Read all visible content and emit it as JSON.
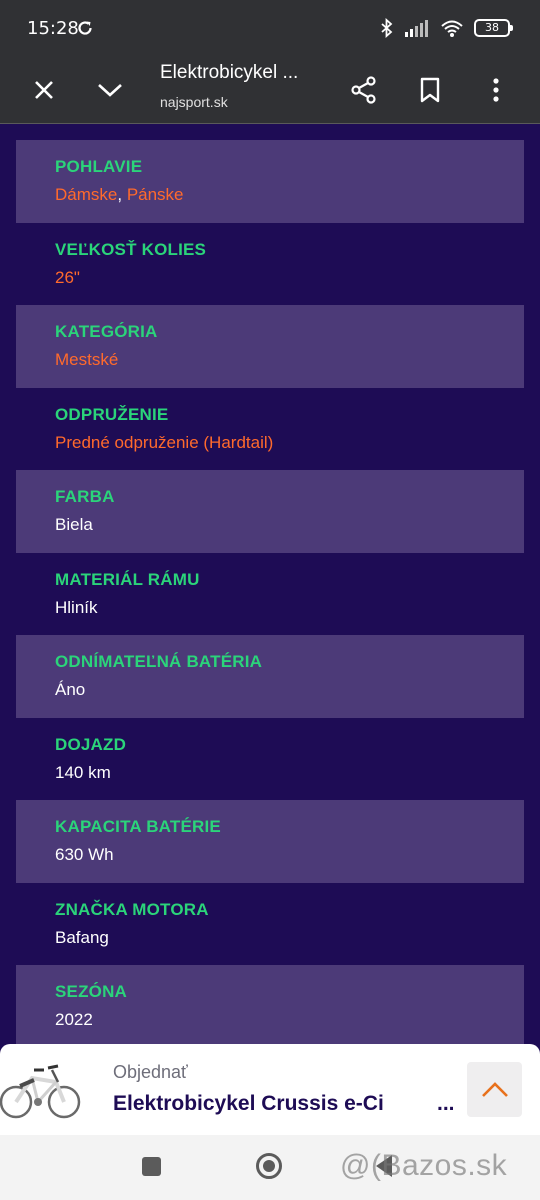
{
  "status_bar": {
    "time": "15:28",
    "battery": "38"
  },
  "toolbar": {
    "title": "Elektrobicykel ...",
    "domain": "najsport.sk"
  },
  "specs": [
    {
      "label": "POHLAVIE",
      "values": [
        "Dámske",
        "Pánske"
      ],
      "separator": ", ",
      "style": "link"
    },
    {
      "label": "VEĽKOSŤ KOLIES",
      "values": [
        "26\""
      ],
      "style": "link"
    },
    {
      "label": "KATEGÓRIA",
      "values": [
        "Mestské"
      ],
      "style": "link"
    },
    {
      "label": "ODPRUŽENIE",
      "values": [
        "Predné odpruženie (Hardtail)"
      ],
      "style": "link"
    },
    {
      "label": "FARBA",
      "values": [
        "Biela"
      ],
      "style": "plain"
    },
    {
      "label": "MATERIÁL RÁMU",
      "values": [
        "Hliník"
      ],
      "style": "plain"
    },
    {
      "label": "ODNÍMATEĽNÁ BATÉRIA",
      "values": [
        "Áno"
      ],
      "style": "plain"
    },
    {
      "label": "DOJAZD",
      "values": [
        "140 km"
      ],
      "style": "plain"
    },
    {
      "label": "KAPACITA BATÉRIE",
      "values": [
        "630 Wh"
      ],
      "style": "plain"
    },
    {
      "label": "ZNAČKA MOTORA",
      "values": [
        "Bafang"
      ],
      "style": "plain"
    },
    {
      "label": "SEZÓNA",
      "values": [
        "2022"
      ],
      "style": "plain"
    }
  ],
  "order_bar": {
    "label": "Objednať",
    "product": "Elektrobicykel Crussis e-Ci",
    "ellipsis": "..."
  },
  "watermark": "@(Bazos.sk",
  "colors": {
    "page_bg": "#1e0c55",
    "row_shaded": "#4c3a78",
    "label": "#2bd47a",
    "link": "#ff6a2c",
    "toolbar": "#303134",
    "up_arrow": "#e8711c"
  },
  "icons": {
    "status": [
      "sync-icon",
      "bluetooth-icon",
      "signal-icon",
      "wifi-icon",
      "battery-icon"
    ],
    "toolbar": [
      "close-icon",
      "chevron-down-icon",
      "share-icon",
      "bookmark-icon",
      "more-vert-icon"
    ],
    "order": [
      "bike-thumbnail",
      "chevron-up-icon"
    ],
    "nav": [
      "recents-icon",
      "home-icon",
      "back-icon"
    ]
  }
}
